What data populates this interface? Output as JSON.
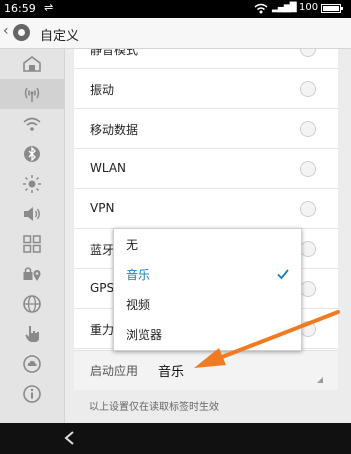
{
  "status_bar": {
    "time": "16:59",
    "battery_text": "100",
    "battery_level_percent": 100
  },
  "action_bar": {
    "title": "自定义"
  },
  "sidebar": {
    "items": [
      {
        "icon": "home-icon"
      },
      {
        "icon": "signal-broadcast-icon",
        "active": true
      },
      {
        "icon": "wifi-icon"
      },
      {
        "icon": "bluetooth-icon"
      },
      {
        "icon": "brightness-icon"
      },
      {
        "icon": "volume-icon"
      },
      {
        "icon": "grid-icon"
      },
      {
        "icon": "lock-location-icon"
      },
      {
        "icon": "globe-icon"
      },
      {
        "icon": "hand-pointer-icon"
      },
      {
        "icon": "cloud-icon"
      },
      {
        "icon": "info-icon"
      }
    ]
  },
  "settings_rows": [
    {
      "label": "静音模式"
    },
    {
      "label": "振动"
    },
    {
      "label": "移动数据"
    },
    {
      "label": "WLAN"
    },
    {
      "label": "VPN"
    },
    {
      "label": "蓝牙"
    },
    {
      "label": "GPS"
    },
    {
      "label": "重力感应"
    }
  ],
  "start_app": {
    "label": "启动应用",
    "value": "音乐"
  },
  "note": "以上设置仅在读取标签时生效",
  "dropdown": {
    "options": [
      {
        "label": "无",
        "selected": false
      },
      {
        "label": "音乐",
        "selected": true
      },
      {
        "label": "视频",
        "selected": false
      },
      {
        "label": "浏览器",
        "selected": false
      }
    ]
  },
  "colors": {
    "accent": "#1a7fb7",
    "annotation_arrow": "#f07b22"
  }
}
